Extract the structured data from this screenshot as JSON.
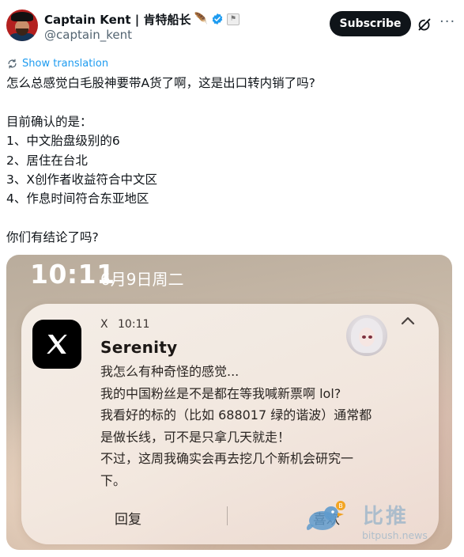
{
  "header": {
    "display_name": "Captain Kent | 肯特船长",
    "handle": "@captain_kent",
    "subscribe_label": "Subscribe",
    "more_label": "···"
  },
  "translate": {
    "label": "Show translation"
  },
  "tweet": {
    "lines": [
      "怎么总感觉白毛股神要带A货了啊，这是出口转内销了吗?",
      "",
      "目前确认的是：",
      "1、中文胎盘级别的6",
      "2、居住在台北",
      "3、X创作者收益符合中文区",
      "4、作息时间符合东亚地区",
      "",
      "你们有结论了吗?"
    ]
  },
  "screenshot": {
    "lock_time": "10:11",
    "lock_date": "6月9日周二",
    "notification": {
      "app": "X",
      "time": "10:11",
      "sender": "Serenity",
      "body_lines": [
        "我怎么有种奇怪的感觉...",
        "我的中国粉丝是不是都在等我喊新票啊 lol?",
        "我看好的标的（比如 688017 绿的谐波）通常都",
        "是做长线，可不是只拿几天就走！",
        "不过，这周我确实会再去挖几个新机会研究一",
        "下。"
      ],
      "reply_label": "回复",
      "like_label": "喜欢"
    }
  },
  "watermark": {
    "brand": "比推",
    "url": "bitpush.news"
  },
  "colors": {
    "link": "#1d9bf0",
    "verified": "#1d9bf0",
    "subscribe_bg": "#0f1419",
    "watermark": "#96b2c8"
  },
  "icons": [
    "feather-icon",
    "verified-icon",
    "flag-icon",
    "grok-icon",
    "more-icon",
    "translate-icon",
    "x-app-icon",
    "collapse-icon",
    "bird-icon"
  ]
}
